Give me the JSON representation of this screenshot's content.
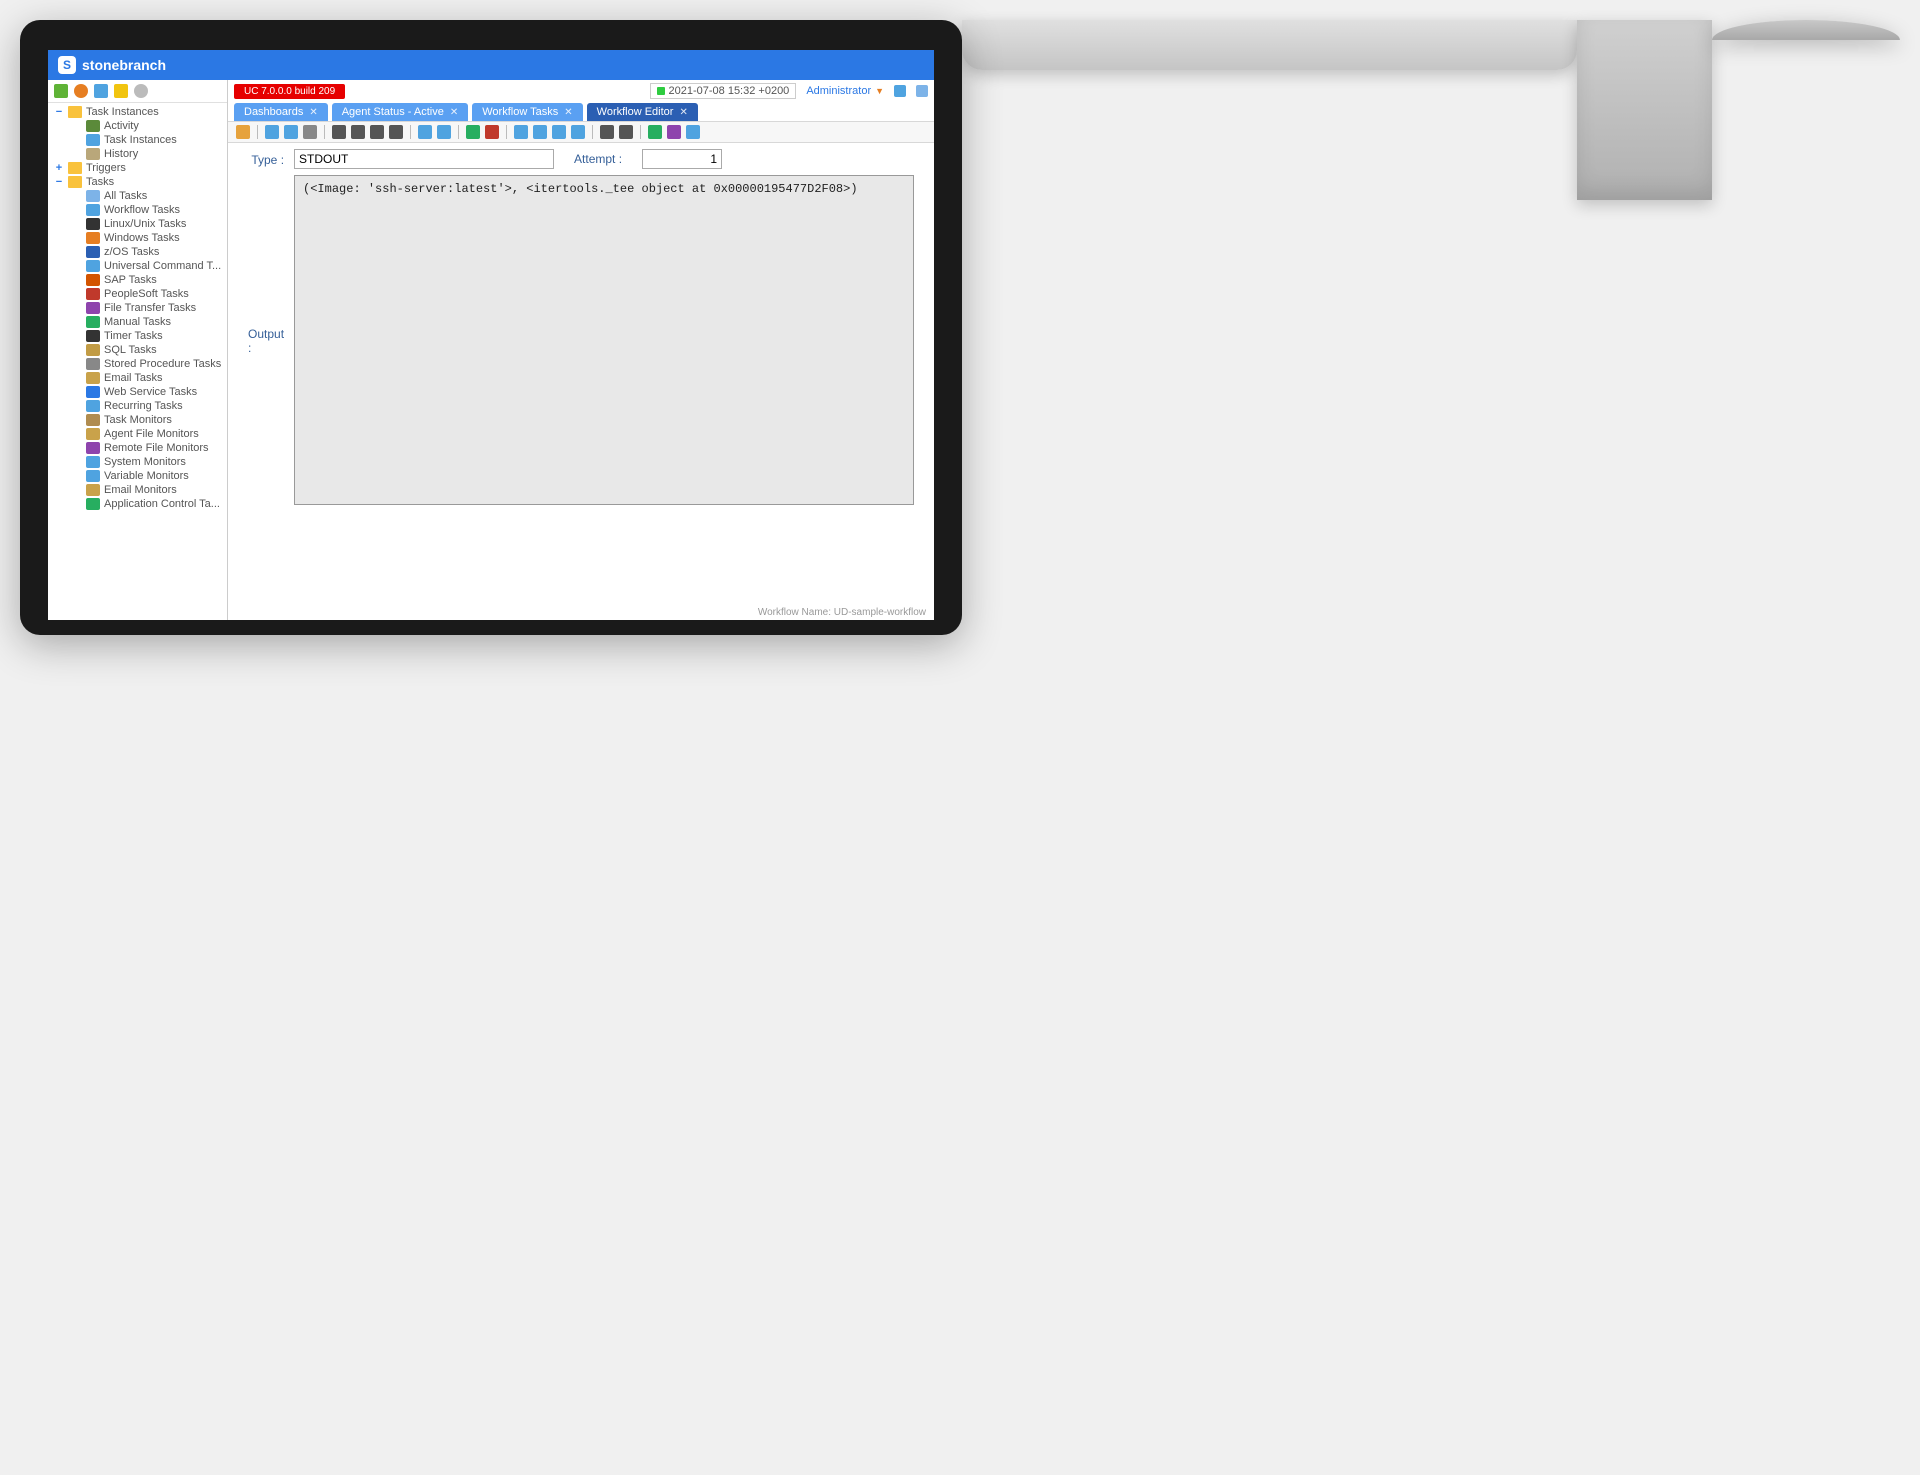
{
  "header": {
    "brand": "stonebranch",
    "logo_letter": "S"
  },
  "topbar": {
    "build": "UC 7.0.0.0 build 209",
    "timestamp": "2021-07-08 15:32 +0200",
    "user": "Administrator"
  },
  "tabs": [
    {
      "label": "Dashboards",
      "active": false
    },
    {
      "label": "Agent Status - Active",
      "active": false
    },
    {
      "label": "Workflow Tasks",
      "active": false
    },
    {
      "label": "Workflow Editor",
      "active": true
    }
  ],
  "sidebar": {
    "top_icons": [
      "grid",
      "globe",
      "page",
      "apps",
      "gear"
    ],
    "tree": [
      {
        "type": "group",
        "toggle": "−",
        "label": "Task Instances",
        "indent": 0,
        "icon": "folder"
      },
      {
        "type": "leaf",
        "label": "Activity",
        "indent": 2,
        "color": "#5b8a3a"
      },
      {
        "type": "leaf",
        "label": "Task Instances",
        "indent": 2,
        "color": "#4fa3e0"
      },
      {
        "type": "leaf",
        "label": "History",
        "indent": 2,
        "color": "#b9a77a"
      },
      {
        "type": "group",
        "toggle": "+",
        "label": "Triggers",
        "indent": 0,
        "icon": "folder"
      },
      {
        "type": "group",
        "toggle": "−",
        "label": "Tasks",
        "indent": 0,
        "icon": "folder"
      },
      {
        "type": "leaf",
        "label": "All Tasks",
        "indent": 2,
        "color": "#7db3e8"
      },
      {
        "type": "leaf",
        "label": "Workflow Tasks",
        "indent": 2,
        "color": "#4fa3e0"
      },
      {
        "type": "leaf",
        "label": "Linux/Unix Tasks",
        "indent": 2,
        "color": "#333"
      },
      {
        "type": "leaf",
        "label": "Windows Tasks",
        "indent": 2,
        "color": "#e67e22"
      },
      {
        "type": "leaf",
        "label": "z/OS Tasks",
        "indent": 2,
        "color": "#2b5fb3"
      },
      {
        "type": "leaf",
        "label": "Universal Command T...",
        "indent": 2,
        "color": "#4fa3e0"
      },
      {
        "type": "leaf",
        "label": "SAP Tasks",
        "indent": 2,
        "color": "#d35400"
      },
      {
        "type": "leaf",
        "label": "PeopleSoft Tasks",
        "indent": 2,
        "color": "#c0392b"
      },
      {
        "type": "leaf",
        "label": "File Transfer Tasks",
        "indent": 2,
        "color": "#8e44ad"
      },
      {
        "type": "leaf",
        "label": "Manual Tasks",
        "indent": 2,
        "color": "#27ae60"
      },
      {
        "type": "leaf",
        "label": "Timer Tasks",
        "indent": 2,
        "color": "#333"
      },
      {
        "type": "leaf",
        "label": "SQL Tasks",
        "indent": 2,
        "color": "#c29c45"
      },
      {
        "type": "leaf",
        "label": "Stored Procedure Tasks",
        "indent": 2,
        "color": "#888"
      },
      {
        "type": "leaf",
        "label": "Email Tasks",
        "indent": 2,
        "color": "#c9a24a"
      },
      {
        "type": "leaf",
        "label": "Web Service Tasks",
        "indent": 2,
        "color": "#2b78e4"
      },
      {
        "type": "leaf",
        "label": "Recurring Tasks",
        "indent": 2,
        "color": "#4fa3e0"
      },
      {
        "type": "leaf",
        "label": "Task Monitors",
        "indent": 2,
        "color": "#b08c4f"
      },
      {
        "type": "leaf",
        "label": "Agent File Monitors",
        "indent": 2,
        "color": "#c9a24a"
      },
      {
        "type": "leaf",
        "label": "Remote File Monitors",
        "indent": 2,
        "color": "#8e44ad"
      },
      {
        "type": "leaf",
        "label": "System Monitors",
        "indent": 2,
        "color": "#4fa3e0"
      },
      {
        "type": "leaf",
        "label": "Variable Monitors",
        "indent": 2,
        "color": "#4fa3e0"
      },
      {
        "type": "leaf",
        "label": "Email Monitors",
        "indent": 2,
        "color": "#c9a24a"
      },
      {
        "type": "leaf",
        "label": "Application Control Ta...",
        "indent": 2,
        "color": "#27ae60"
      }
    ]
  },
  "editor_toolbar_icons": [
    "up-arrow",
    "sep",
    "save",
    "save-all",
    "print",
    "sep",
    "pointer",
    "connect-line",
    "curve",
    "line",
    "sep",
    "undo",
    "redo",
    "sep",
    "insert",
    "delete",
    "sep",
    "zoom-in",
    "zoom-out",
    "zoom-fit",
    "zoom-100",
    "sep",
    "grid",
    "tree-view",
    "sep",
    "refresh",
    "validate",
    "run"
  ],
  "form": {
    "type_label": "Type :",
    "type_value": "STDOUT",
    "attempt_label": "Attempt :",
    "attempt_value": "1",
    "output_label": "Output :",
    "output_text": "(<Image: 'ssh-server:latest'>, <itertools._tee object at 0x00000195477D2F08>)"
  },
  "statusbar": "Workflow Name: UD-sample-workflow"
}
